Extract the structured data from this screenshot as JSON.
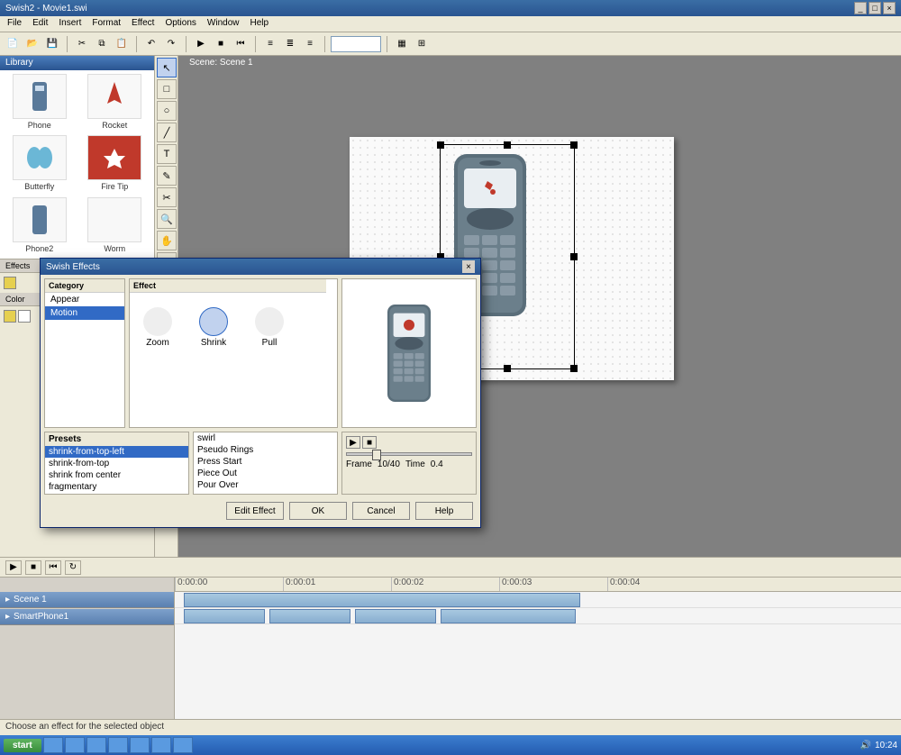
{
  "app": {
    "title": "Swish2 - Movie1.swi"
  },
  "menu": [
    "File",
    "Edit",
    "Insert",
    "Format",
    "Effect",
    "Options",
    "Window",
    "Help"
  ],
  "toolbars": {
    "row1_icons": [
      "new",
      "open",
      "save",
      "sep",
      "cut",
      "copy",
      "paste",
      "sep",
      "undo",
      "redo",
      "sep",
      "play",
      "stop",
      "rewind",
      "sep",
      "align-l",
      "align-c",
      "align-r",
      "sep",
      "combo",
      "sep",
      "zoom-in",
      "zoom-out"
    ]
  },
  "sidebar": {
    "header": "Library",
    "items": [
      {
        "label": "Phone",
        "color": "#5a7a9a"
      },
      {
        "label": "Rocket",
        "color": "#c0392b"
      },
      {
        "label": "Butterfly",
        "color": "#6bb7d6"
      },
      {
        "label": "Fire Tip",
        "color": "#c0392b"
      },
      {
        "label": "Phone2",
        "color": "#5a7a9a"
      },
      {
        "label": "Worm",
        "color": "#888"
      }
    ],
    "tabs": [
      "Effects",
      "Color"
    ],
    "swatches": [
      "#e6d050",
      "#ffffff",
      "#000000"
    ]
  },
  "toolbox": [
    "↖",
    "□",
    "○",
    "╱",
    "T",
    "✎",
    "✂",
    "🔍",
    "✋",
    "⬚",
    "▦",
    "⬛",
    "▭"
  ],
  "canvas": {
    "title": "Scene: Scene 1"
  },
  "dialog": {
    "title": "Swish Effects",
    "headers": {
      "category": "Category",
      "effect": "Effect",
      "preview": "",
      "presets": "Presets"
    },
    "categories": [
      "Appear",
      "Motion"
    ],
    "selected_cat": 1,
    "effects": [
      {
        "name": "Zoom"
      },
      {
        "name": "Shrink",
        "selected": true
      },
      {
        "name": "Pull"
      }
    ],
    "presets_left": [
      "shrink-from-top-left",
      "shrink-from-top",
      "shrink from center",
      "fragmentary"
    ],
    "presets_right": [
      "swirl",
      "Pseudo Rings",
      "Press Start",
      "Piece Out",
      "Pour Over"
    ],
    "play": {
      "frame_label": "Frame",
      "frame": "10/40",
      "time_label": "Time",
      "time": "0.4"
    },
    "buttons": {
      "edit": "Edit Effect",
      "ok": "OK",
      "cancel": "Cancel",
      "help": "Help"
    }
  },
  "timeline": {
    "markers": [
      "0:00:00",
      "0:00:01",
      "0:00:02",
      "0:00:03",
      "0:00:04"
    ],
    "tracks": [
      {
        "label": "Scene 1",
        "clips": [
          {
            "start": 10,
            "len": 440
          }
        ]
      },
      {
        "label": "SmartPhone1",
        "clips": [
          {
            "start": 10,
            "len": 90
          },
          {
            "start": 105,
            "len": 90
          },
          {
            "start": 200,
            "len": 90
          },
          {
            "start": 295,
            "len": 150
          }
        ]
      }
    ]
  },
  "status": "Choose an effect for the selected object",
  "taskbar": {
    "start": "start",
    "time": "10:24"
  }
}
